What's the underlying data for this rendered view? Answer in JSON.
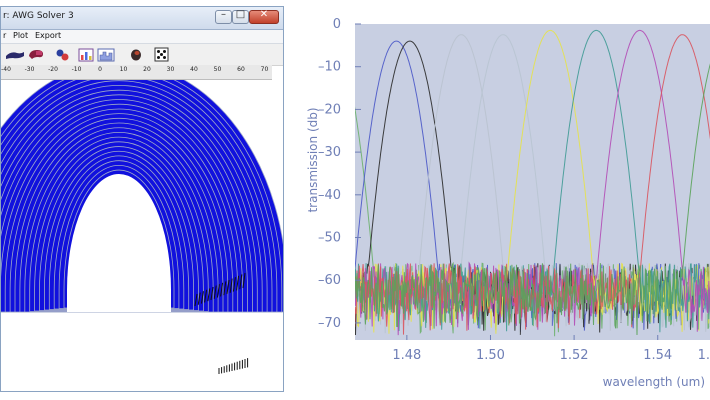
{
  "window": {
    "title": "r: AWG Solver 3",
    "buttons": {
      "minimize_glyph": "–",
      "maximize_glyph": "□",
      "close_glyph": "✕"
    }
  },
  "menu": [
    "r",
    "Plot",
    "Export"
  ],
  "toolbar": {
    "icons": [
      "waveguide-icon",
      "magnet-icon",
      "molecule-icon",
      "bar-chart-icon",
      "histogram-icon",
      "beetle-icon",
      "dice-icon"
    ]
  },
  "ruler": {
    "labels": [
      "-40",
      "-30",
      "-20",
      "-10",
      "0",
      "10",
      "20",
      "30",
      "40",
      "50",
      "60",
      "70"
    ]
  },
  "colors": {
    "waveguide_fill": "#1111dd",
    "waveguide_stroke": "#9ea8c8",
    "plot_bg": "#c8cfe2",
    "axis_text": "#6f7fb6"
  },
  "chart_data": {
    "type": "line",
    "xlabel": "wavelength (um)",
    "ylabel": "transmission (db)",
    "x_ticks": [
      "1.48",
      "1.50",
      "1.52",
      "1.54",
      "1."
    ],
    "y_ticks": [
      "0",
      "–10",
      "–20",
      "–30",
      "–40",
      "–50",
      "–60",
      "–70"
    ],
    "xlim": [
      1.4676,
      1.5525
    ],
    "ylim": [
      -74,
      0
    ],
    "grid": false,
    "series": [
      {
        "color": "#6bb06b",
        "peak_wavelength": 1.462,
        "peak_db": -3
      },
      {
        "color": "#4a58c8",
        "peak_wavelength": 1.4775,
        "peak_db": -4
      },
      {
        "color": "#2a2a2a",
        "peak_wavelength": 1.4807,
        "peak_db": -4
      },
      {
        "color": "#b9c2cf",
        "peak_wavelength": 1.493,
        "peak_db": -2.5
      },
      {
        "color": "#b8c4d2",
        "peak_wavelength": 1.503,
        "peak_db": -2.5
      },
      {
        "color": "#e5e24a",
        "peak_wavelength": 1.5143,
        "peak_db": -1.5
      },
      {
        "color": "#3f9a95",
        "peak_wavelength": 1.5253,
        "peak_db": -1.5
      },
      {
        "color": "#b24bb6",
        "peak_wavelength": 1.5357,
        "peak_db": -1.5
      },
      {
        "color": "#d9545e",
        "peak_wavelength": 1.5459,
        "peak_db": -2.5
      },
      {
        "color": "#5aa35a",
        "peak_wavelength": 1.556,
        "peak_db": -3
      }
    ],
    "noise_floor_db": [
      -52,
      -70
    ]
  }
}
